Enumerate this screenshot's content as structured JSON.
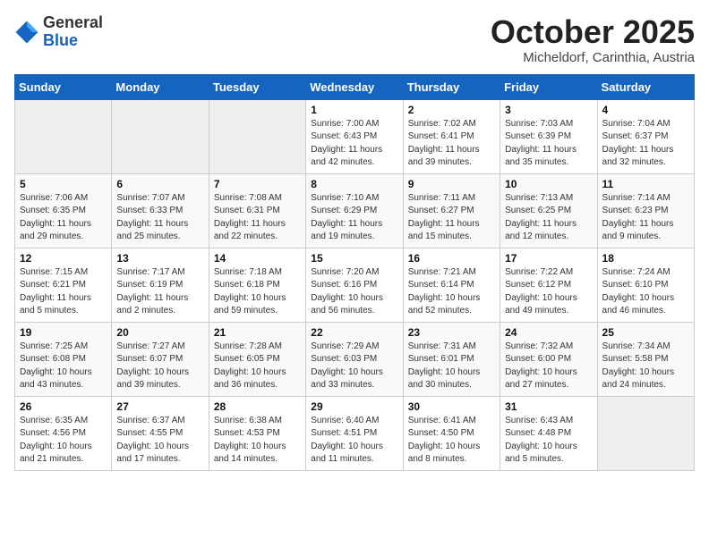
{
  "header": {
    "logo_general": "General",
    "logo_blue": "Blue",
    "month_title": "October 2025",
    "location": "Micheldorf, Carinthia, Austria"
  },
  "calendar": {
    "weekdays": [
      "Sunday",
      "Monday",
      "Tuesday",
      "Wednesday",
      "Thursday",
      "Friday",
      "Saturday"
    ],
    "rows": [
      [
        {
          "day": "",
          "info": ""
        },
        {
          "day": "",
          "info": ""
        },
        {
          "day": "",
          "info": ""
        },
        {
          "day": "1",
          "info": "Sunrise: 7:00 AM\nSunset: 6:43 PM\nDaylight: 11 hours\nand 42 minutes."
        },
        {
          "day": "2",
          "info": "Sunrise: 7:02 AM\nSunset: 6:41 PM\nDaylight: 11 hours\nand 39 minutes."
        },
        {
          "day": "3",
          "info": "Sunrise: 7:03 AM\nSunset: 6:39 PM\nDaylight: 11 hours\nand 35 minutes."
        },
        {
          "day": "4",
          "info": "Sunrise: 7:04 AM\nSunset: 6:37 PM\nDaylight: 11 hours\nand 32 minutes."
        }
      ],
      [
        {
          "day": "5",
          "info": "Sunrise: 7:06 AM\nSunset: 6:35 PM\nDaylight: 11 hours\nand 29 minutes."
        },
        {
          "day": "6",
          "info": "Sunrise: 7:07 AM\nSunset: 6:33 PM\nDaylight: 11 hours\nand 25 minutes."
        },
        {
          "day": "7",
          "info": "Sunrise: 7:08 AM\nSunset: 6:31 PM\nDaylight: 11 hours\nand 22 minutes."
        },
        {
          "day": "8",
          "info": "Sunrise: 7:10 AM\nSunset: 6:29 PM\nDaylight: 11 hours\nand 19 minutes."
        },
        {
          "day": "9",
          "info": "Sunrise: 7:11 AM\nSunset: 6:27 PM\nDaylight: 11 hours\nand 15 minutes."
        },
        {
          "day": "10",
          "info": "Sunrise: 7:13 AM\nSunset: 6:25 PM\nDaylight: 11 hours\nand 12 minutes."
        },
        {
          "day": "11",
          "info": "Sunrise: 7:14 AM\nSunset: 6:23 PM\nDaylight: 11 hours\nand 9 minutes."
        }
      ],
      [
        {
          "day": "12",
          "info": "Sunrise: 7:15 AM\nSunset: 6:21 PM\nDaylight: 11 hours\nand 5 minutes."
        },
        {
          "day": "13",
          "info": "Sunrise: 7:17 AM\nSunset: 6:19 PM\nDaylight: 11 hours\nand 2 minutes."
        },
        {
          "day": "14",
          "info": "Sunrise: 7:18 AM\nSunset: 6:18 PM\nDaylight: 10 hours\nand 59 minutes."
        },
        {
          "day": "15",
          "info": "Sunrise: 7:20 AM\nSunset: 6:16 PM\nDaylight: 10 hours\nand 56 minutes."
        },
        {
          "day": "16",
          "info": "Sunrise: 7:21 AM\nSunset: 6:14 PM\nDaylight: 10 hours\nand 52 minutes."
        },
        {
          "day": "17",
          "info": "Sunrise: 7:22 AM\nSunset: 6:12 PM\nDaylight: 10 hours\nand 49 minutes."
        },
        {
          "day": "18",
          "info": "Sunrise: 7:24 AM\nSunset: 6:10 PM\nDaylight: 10 hours\nand 46 minutes."
        }
      ],
      [
        {
          "day": "19",
          "info": "Sunrise: 7:25 AM\nSunset: 6:08 PM\nDaylight: 10 hours\nand 43 minutes."
        },
        {
          "day": "20",
          "info": "Sunrise: 7:27 AM\nSunset: 6:07 PM\nDaylight: 10 hours\nand 39 minutes."
        },
        {
          "day": "21",
          "info": "Sunrise: 7:28 AM\nSunset: 6:05 PM\nDaylight: 10 hours\nand 36 minutes."
        },
        {
          "day": "22",
          "info": "Sunrise: 7:29 AM\nSunset: 6:03 PM\nDaylight: 10 hours\nand 33 minutes."
        },
        {
          "day": "23",
          "info": "Sunrise: 7:31 AM\nSunset: 6:01 PM\nDaylight: 10 hours\nand 30 minutes."
        },
        {
          "day": "24",
          "info": "Sunrise: 7:32 AM\nSunset: 6:00 PM\nDaylight: 10 hours\nand 27 minutes."
        },
        {
          "day": "25",
          "info": "Sunrise: 7:34 AM\nSunset: 5:58 PM\nDaylight: 10 hours\nand 24 minutes."
        }
      ],
      [
        {
          "day": "26",
          "info": "Sunrise: 6:35 AM\nSunset: 4:56 PM\nDaylight: 10 hours\nand 21 minutes."
        },
        {
          "day": "27",
          "info": "Sunrise: 6:37 AM\nSunset: 4:55 PM\nDaylight: 10 hours\nand 17 minutes."
        },
        {
          "day": "28",
          "info": "Sunrise: 6:38 AM\nSunset: 4:53 PM\nDaylight: 10 hours\nand 14 minutes."
        },
        {
          "day": "29",
          "info": "Sunrise: 6:40 AM\nSunset: 4:51 PM\nDaylight: 10 hours\nand 11 minutes."
        },
        {
          "day": "30",
          "info": "Sunrise: 6:41 AM\nSunset: 4:50 PM\nDaylight: 10 hours\nand 8 minutes."
        },
        {
          "day": "31",
          "info": "Sunrise: 6:43 AM\nSunset: 4:48 PM\nDaylight: 10 hours\nand 5 minutes."
        },
        {
          "day": "",
          "info": ""
        }
      ]
    ]
  }
}
